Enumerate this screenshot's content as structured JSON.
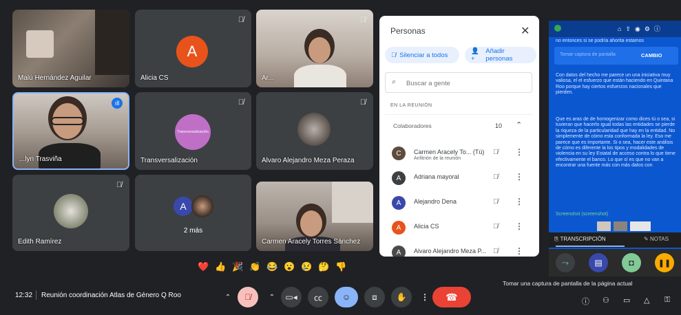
{
  "tiles": {
    "t1": {
      "name": "Malú Hernández Aguilar"
    },
    "t2": {
      "name": "Alicia CS",
      "initial": "A"
    },
    "t3": {
      "name": "Ar..."
    },
    "t4": {
      "name": "...lyn Trasviña"
    },
    "t5": {
      "name": "Transversalización",
      "logo_text": "Transversalización"
    },
    "t6": {
      "name": "Alvaro Alejandro Meza Peraza"
    },
    "t7": {
      "name": "Edith Ramírez"
    },
    "t8": {
      "name": "2 más",
      "initial": "A"
    },
    "t9": {
      "name": "Carmen Aracely Torres Sánchez"
    }
  },
  "people_panel": {
    "title": "Personas",
    "mute_all": "Silenciar a todos",
    "add_people": "Añadir personas",
    "search_placeholder": "Buscar a gente",
    "section": "EN LA REUNIÓN",
    "group_label": "Colaboradores",
    "group_count": "10",
    "participants": [
      {
        "name": "Carmen Aracely To...  (Tú)",
        "sub": "Anfitrión de la reunión",
        "initial": "C",
        "color": "#5f4b3c"
      },
      {
        "name": "Adriana mayoral",
        "sub": "",
        "initial": "A",
        "color": "#3c4043"
      },
      {
        "name": "Alejandro Dena",
        "sub": "",
        "initial": "A",
        "color": "#3949ab"
      },
      {
        "name": "Alicia CS",
        "sub": "",
        "initial": "A",
        "color": "#e8531c"
      },
      {
        "name": "Alvaro Alejandro Meza P...",
        "sub": "",
        "initial": "A",
        "color": "#4a4a4a"
      }
    ]
  },
  "side_panel": {
    "top_text": "no entonces si se podría ahorita estamos",
    "banner_text": "Tomar captura de pantalla",
    "banner_action": "CAMBIO",
    "paragraph1": "Con datos del hecho me parece un una iniciativa muy valiosa, el el esfuerzo que están haciendo en Quintana Roo porque hay ciertos esfuerzos nacionales que pierden.",
    "paragraph2": "Que es aras de de homogenizar como dices tú o sea, si tuvieran que hacerlo igual todas las entidades se pierde la riqueza de la particularidad que hay en la entidad. No simplemente de cómo esta conformada la ley. Eso me parece que es importante. Si o sea, hacer este análisis de cómo es diferente la los tipos y modalidades de violencia en su ley Estatal de acceso contra lo que tiene efectivamente el banco. Lo que sí es que no van a encontrar una fuente más con más datos con",
    "screenshot_label": "Screenshot (screenshot)",
    "tab_transcription": "TRANSCRIPCIÓN",
    "tab_notes": "NOTAS"
  },
  "bottom": {
    "time": "12:32",
    "meeting_title": "Reunión coordinación Atlas de Género Q Roo",
    "tooltip": "Tomar una captura de pantalla de la página actual"
  },
  "emojis": [
    "❤️",
    "👍",
    "🎉",
    "👏",
    "😂",
    "😮",
    "😢",
    "🤔",
    "👎"
  ],
  "colors": {
    "accent": "#1a73e8",
    "end_call": "#ea4335",
    "background": "#202124"
  }
}
